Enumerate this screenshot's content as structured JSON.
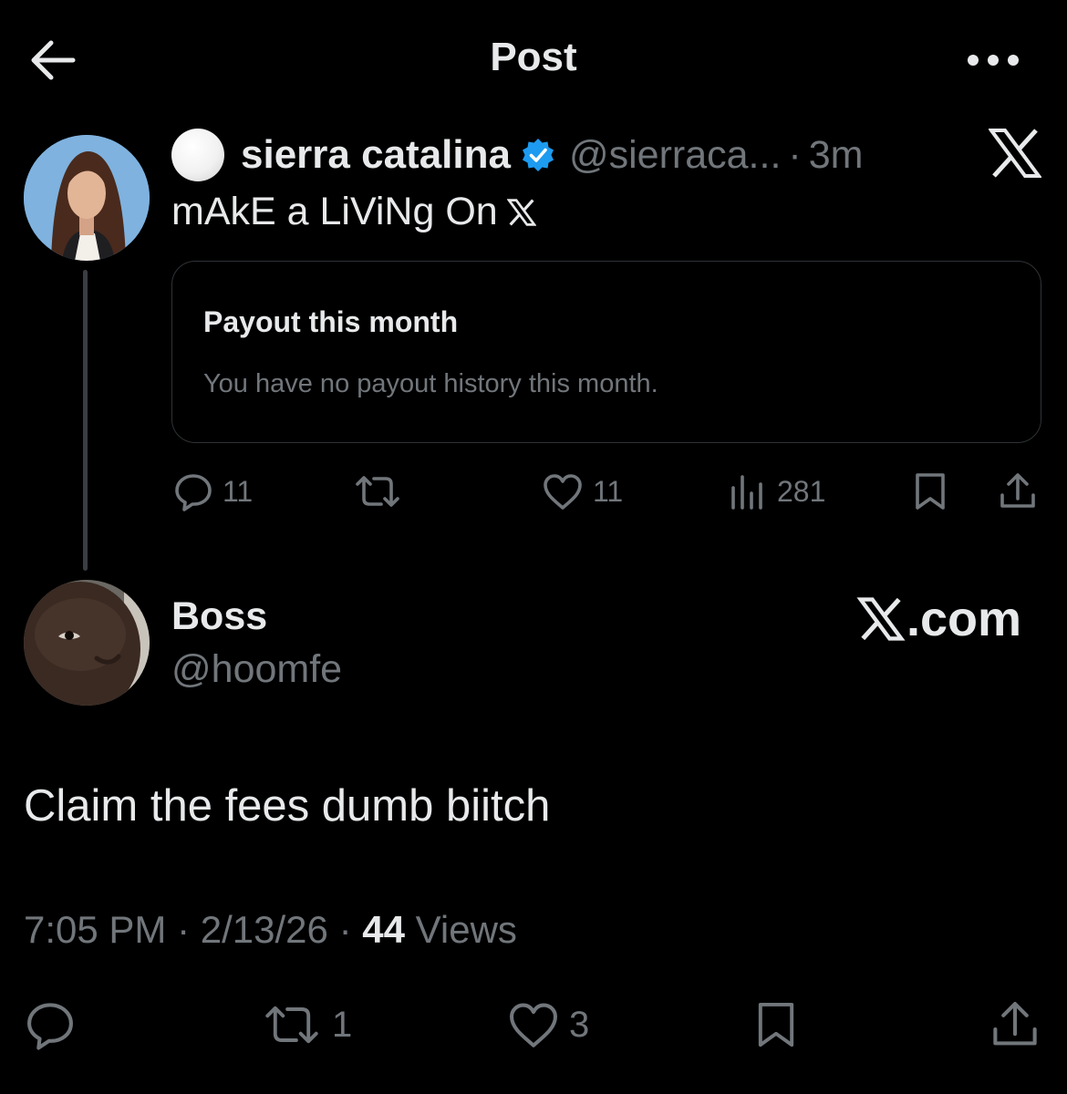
{
  "header": {
    "title": "Post",
    "back_icon": "arrow-left-icon",
    "more_icon": "more-dots-icon"
  },
  "quoted_post": {
    "emoji": "white-circle",
    "display_name": "sierra catalina",
    "verified_icon": "verified-badge-icon",
    "handle": "@sierraca...",
    "separator": "·",
    "time": "3m",
    "brand_icon": "x-logo-icon",
    "text": "mAkE a LiViNg On",
    "card": {
      "title": "Payout this month",
      "subtitle": "You have no payout history this month."
    },
    "actions": {
      "replies": "11",
      "reposts": "",
      "likes": "11",
      "views": "281"
    }
  },
  "reply": {
    "display_name": "Boss",
    "handle": "@hoomfe",
    "brand_text": ".com",
    "text": "Claim the fees dumb biitch",
    "meta": {
      "time": "7:05 PM",
      "dot1": "·",
      "date": "2/13/26",
      "dot2": "·",
      "views_count": "44",
      "views_label": "Views"
    },
    "actions": {
      "replies": "",
      "reposts": "1",
      "likes": "3"
    }
  },
  "colors": {
    "background": "#000000",
    "text_primary": "#e7e9ea",
    "text_secondary": "#71767b",
    "border": "#2f3336",
    "verified": "#1d9bf0"
  }
}
